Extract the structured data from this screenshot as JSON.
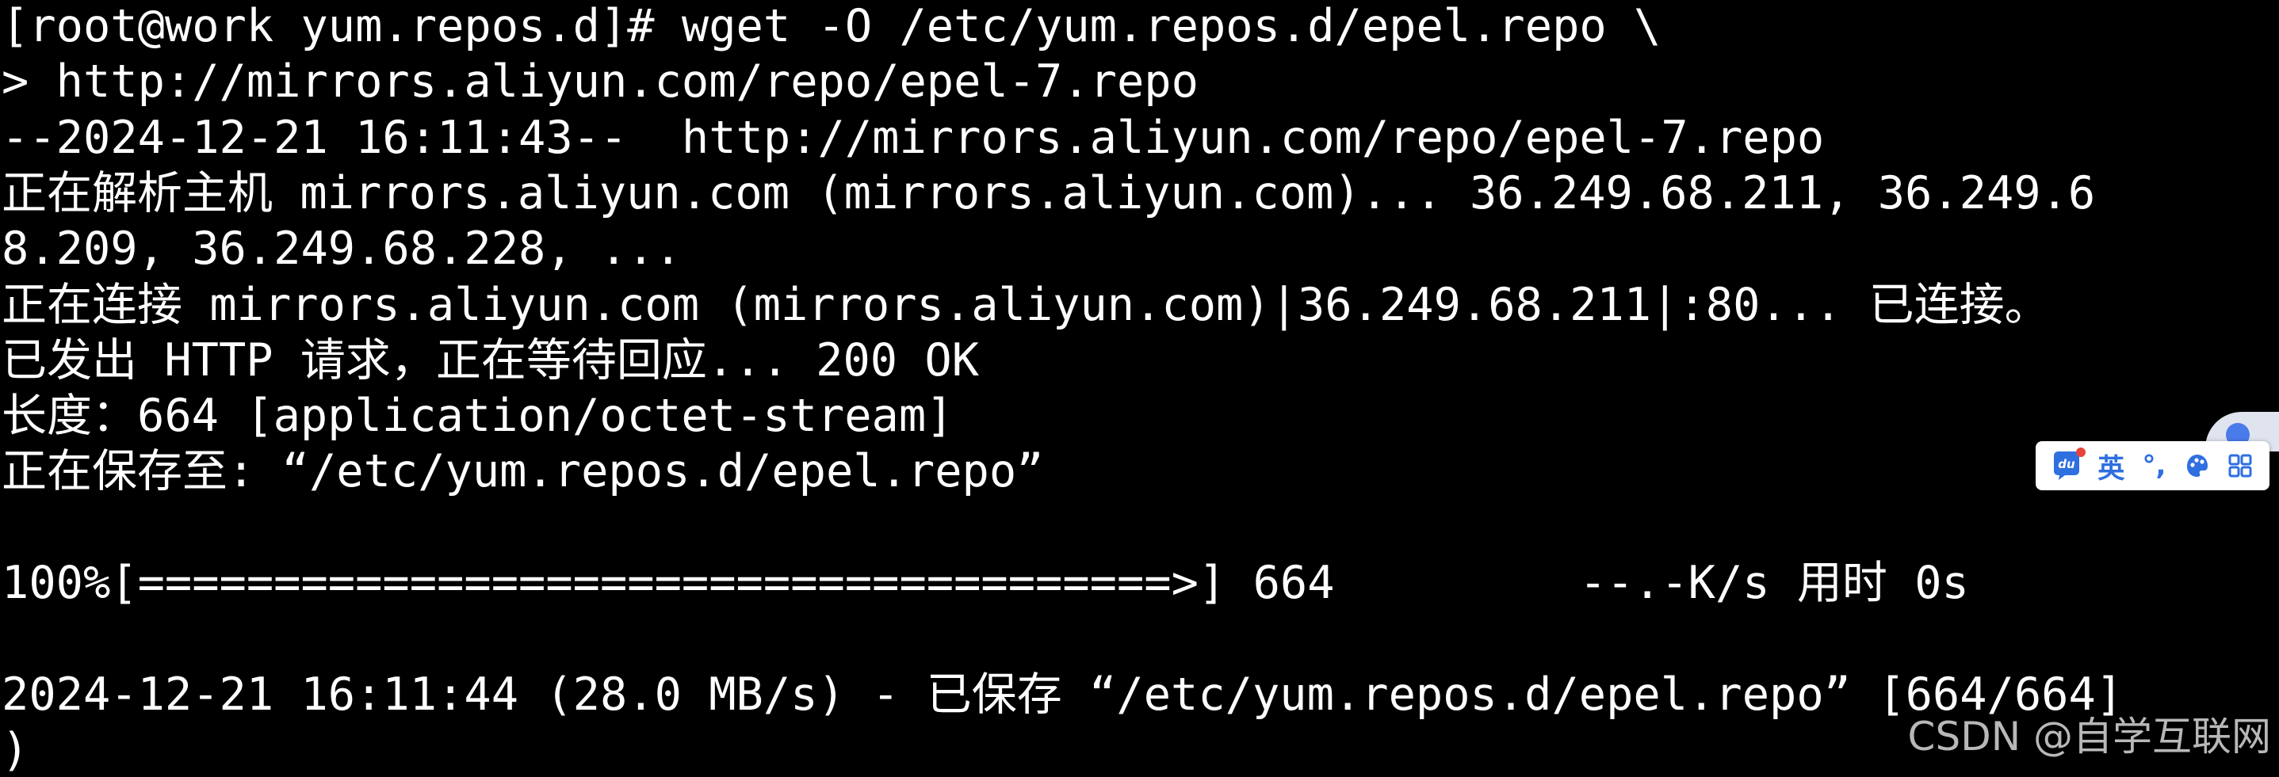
{
  "terminal": {
    "lines": [
      "[root@work yum.repos.d]# wget -O /etc/yum.repos.d/epel.repo \\",
      "> http://mirrors.aliyun.com/repo/epel-7.repo",
      "--2024-12-21 16:11:43--  http://mirrors.aliyun.com/repo/epel-7.repo",
      "正在解析主机 mirrors.aliyun.com (mirrors.aliyun.com)... 36.249.68.211, 36.249.6",
      "8.209, 36.249.68.228, ...",
      "正在连接 mirrors.aliyun.com (mirrors.aliyun.com)|36.249.68.211|:80... 已连接。",
      "已发出 HTTP 请求，正在等待回应... 200 OK",
      "长度：664 [application/octet-stream]",
      "正在保存至: “/etc/yum.repos.d/epel.repo”",
      "",
      "100%[======================================>] 664         --.-K/s 用时 0s",
      "",
      "2024-12-21 16:11:44 (28.0 MB/s) - 已保存 “/etc/yum.repos.d/epel.repo” [664/664]",
      ")"
    ]
  },
  "watermark": "CSDN @自学互联网",
  "ime_toolbar": {
    "logo_icon": "baidu-ime-logo-icon",
    "mode_label": "英",
    "punct_label": "°,",
    "skin_icon": "skin-icon",
    "grid_icon": "toolbox-grid-icon",
    "accent": "#2f6fe0"
  }
}
